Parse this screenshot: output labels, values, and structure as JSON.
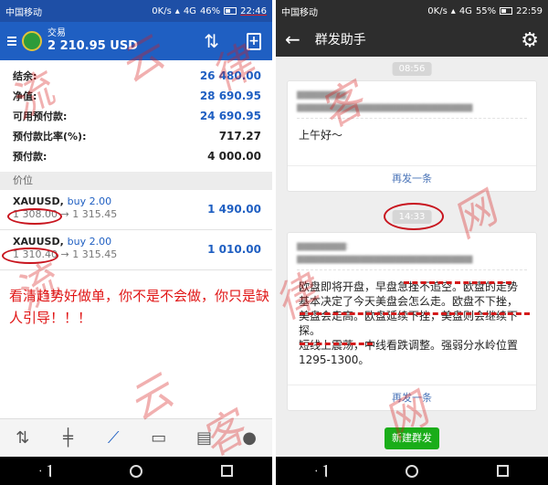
{
  "left": {
    "status": {
      "carrier": "中国移动",
      "speed": "0K/s",
      "network": "4G",
      "battery": "46%",
      "time": "22:46"
    },
    "appbar": {
      "account_label": "交易",
      "balance": "2 210.95 USD"
    },
    "summary": [
      {
        "label": "结余:",
        "value": "26 480.00"
      },
      {
        "label": "净值:",
        "value": "28 690.95"
      },
      {
        "label": "可用预付款:",
        "value": "24 690.95"
      },
      {
        "label": "预付款比率(%):",
        "value": "717.27"
      },
      {
        "label": "预付款:",
        "value": "4 000.00"
      }
    ],
    "section_title": "价位",
    "positions": [
      {
        "symbol": "XAUUSD,",
        "side": "buy 2.00",
        "open": "1 308.00",
        "arrow": "→",
        "current": "1 315.45",
        "profit": "1 490.00"
      },
      {
        "symbol": "XAUUSD,",
        "side": "buy 2.00",
        "open": "1 310.40",
        "arrow": "→",
        "current": "1 315.45",
        "profit": "1 010.00"
      }
    ],
    "promo_text": "看清趋势好做单，你不是不会做，你只是缺人引导！！！"
  },
  "right": {
    "status": {
      "carrier": "中国移动",
      "speed": "0K/s",
      "network": "4G",
      "battery": "55%",
      "time": "22:59"
    },
    "appbar": {
      "title": "群发助手"
    },
    "timestamp1": "08:56",
    "message1": "上午好～",
    "timestamp2": "14:33",
    "message2": "欧盘即将开盘，早盘急挫不追空。欧盘的走势基本决定了今天美盘会怎么走。欧盘不下挫，美盘会走高。欧盘延续下挫，美盘则会继续下探。\n短线上震荡，中线看跌调整。强弱分水岭位置1295-1300。",
    "resend_label": "再发一条",
    "new_broadcast_label": "新建群发"
  },
  "watermark": {
    "chars": [
      "流",
      "云",
      "律",
      "客",
      "网"
    ]
  },
  "colors": {
    "mt_blue": "#1f5fc2",
    "annotation_red": "#c8141e",
    "wechat_green": "#1aad19",
    "wechat_dark": "#2d2d2d"
  }
}
